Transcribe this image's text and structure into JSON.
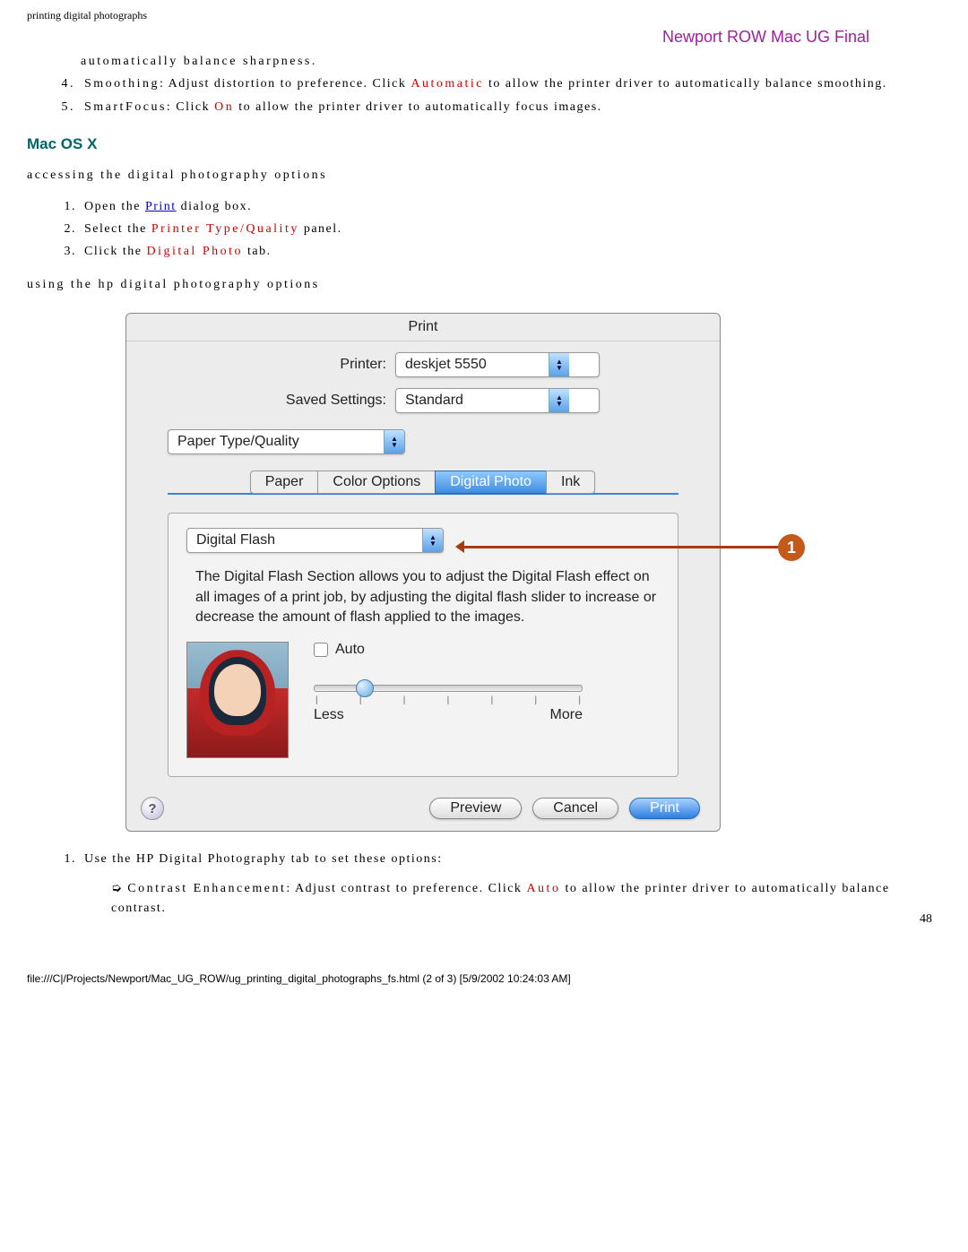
{
  "header": {
    "title": "printing digital photographs"
  },
  "watermark": "Newport ROW Mac UG Final",
  "intro_cont": "automatically balance sharpness.",
  "item4": {
    "label": "Smoothing",
    "text1": ": Adjust distortion to preference. Click ",
    "highlight": "Automatic",
    "text2": " to allow the printer driver to automatically balance smoothing."
  },
  "item5": {
    "label": "SmartFocus",
    "text1": ": Click ",
    "highlight": "On",
    "text2": " to allow the printer driver to automatically focus images."
  },
  "macosx_heading": "Mac OS X",
  "accessing": "accessing the digital photography options",
  "steps": {
    "s1a": "Open the ",
    "s1link": "Print",
    "s1b": " dialog box.",
    "s2a": "Select the ",
    "s2red": "Printer Type/Quality",
    "s2b": " panel.",
    "s3a": "Click the ",
    "s3red": "Digital Photo",
    "s3b": " tab."
  },
  "using": "using the hp digital photography options",
  "dialog": {
    "title": "Print",
    "printer_label": "Printer:",
    "printer_value": "deskjet 5550",
    "saved_label": "Saved Settings:",
    "saved_value": "Standard",
    "panel_value": "Paper Type/Quality",
    "tabs": {
      "paper": "Paper",
      "color": "Color Options",
      "digital": "Digital Photo",
      "ink": "Ink"
    },
    "sub_select": "Digital Flash",
    "description": "The Digital Flash Section allows you to adjust the Digital Flash effect on all images of a print job, by adjusting the digital flash slider to increase or decrease the amount of flash applied to the images.",
    "auto_label": "Auto",
    "less": "Less",
    "more": "More",
    "preview_btn": "Preview",
    "cancel_btn": "Cancel",
    "print_btn": "Print"
  },
  "callout": "1",
  "after": {
    "line1": "Use the HP Digital Photography tab to set these options:",
    "sub_label": "Contrast Enhancement",
    "sub_t1": ": Adjust contrast to preference. Click ",
    "sub_red": "Auto",
    "sub_t2": " to allow the printer driver to automatically balance contrast."
  },
  "page_num": "48",
  "footer": "file:///C|/Projects/Newport/Mac_UG_ROW/ug_printing_digital_photographs_fs.html (2 of 3) [5/9/2002 10:24:03 AM]"
}
